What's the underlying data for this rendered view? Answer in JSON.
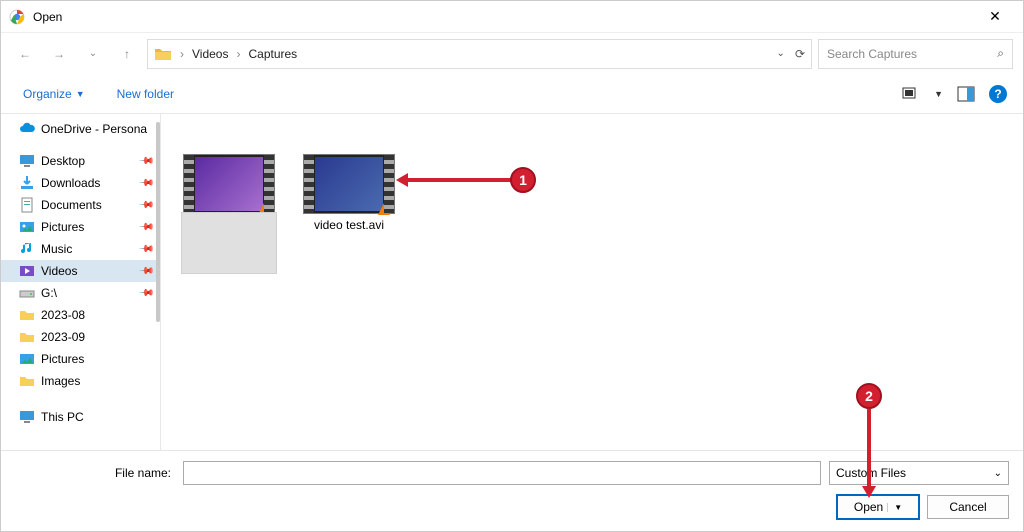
{
  "window": {
    "title": "Open"
  },
  "breadcrumbs": {
    "root": "Videos",
    "sub": "Captures"
  },
  "search": {
    "placeholder": "Search Captures"
  },
  "commands": {
    "organize": "Organize",
    "newfolder": "New folder"
  },
  "sidebar": {
    "onedrive": "OneDrive - Persona",
    "items": [
      {
        "label": "Desktop",
        "pin": true,
        "kind": "desktop"
      },
      {
        "label": "Downloads",
        "pin": true,
        "kind": "downloads"
      },
      {
        "label": "Documents",
        "pin": true,
        "kind": "documents"
      },
      {
        "label": "Pictures",
        "pin": true,
        "kind": "pictures"
      },
      {
        "label": "Music",
        "pin": true,
        "kind": "music"
      },
      {
        "label": "Videos",
        "pin": true,
        "kind": "videos",
        "selected": true
      },
      {
        "label": "G:\\",
        "pin": true,
        "kind": "drive"
      },
      {
        "label": "2023-08",
        "pin": false,
        "kind": "folder"
      },
      {
        "label": "2023-09",
        "pin": false,
        "kind": "folder"
      },
      {
        "label": "Pictures",
        "pin": false,
        "kind": "pictures"
      },
      {
        "label": "Images",
        "pin": false,
        "kind": "folder"
      }
    ],
    "thispc": "This PC"
  },
  "files": {
    "item1_caption": "",
    "item2_caption": "video test.avi"
  },
  "footer": {
    "filename_label": "File name:",
    "filter": "Custom Files",
    "open": "Open",
    "cancel": "Cancel"
  },
  "annotations": {
    "badge1": "1",
    "badge2": "2"
  }
}
